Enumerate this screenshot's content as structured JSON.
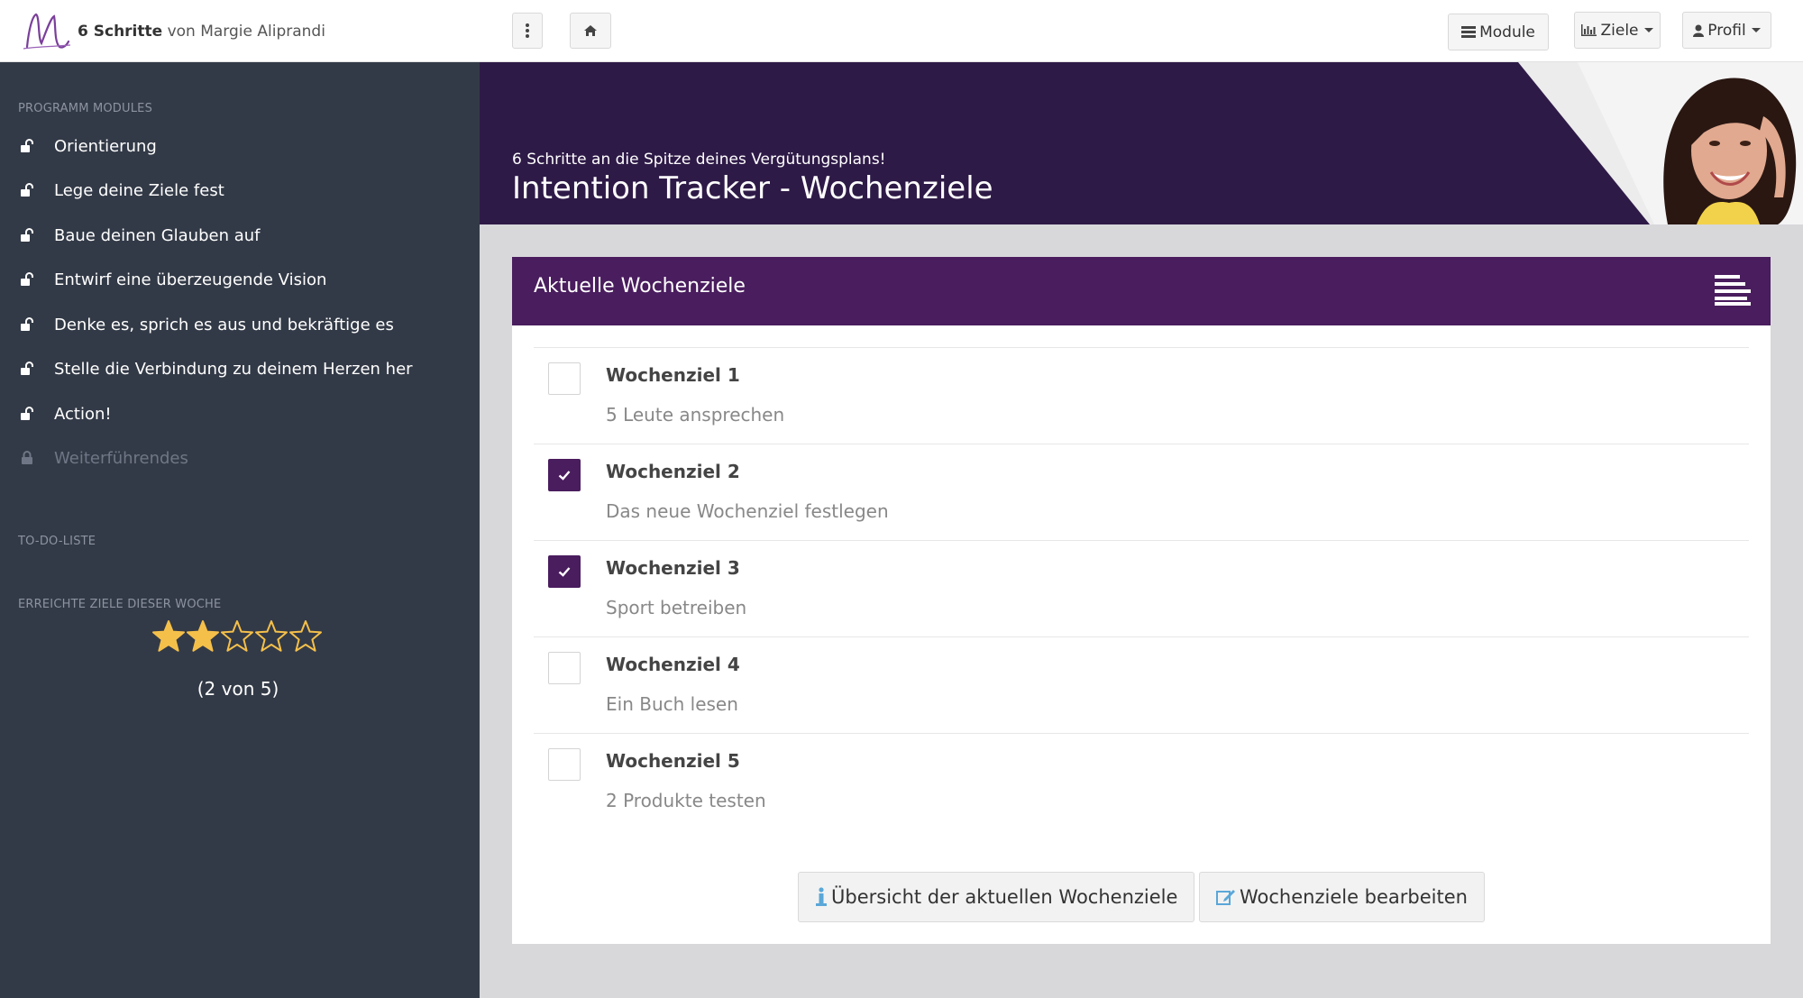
{
  "header": {
    "brand_bold": "6 Schritte",
    "brand_rest": " von Margie Aliprandi",
    "nav": {
      "modules_label": "Module",
      "goals_label": "Ziele",
      "profile_label": "Profil"
    }
  },
  "sidebar": {
    "modules_heading": "PROGRAMM MODULES",
    "items": [
      {
        "label": "Orientierung",
        "locked": false
      },
      {
        "label": "Lege deine Ziele fest",
        "locked": false
      },
      {
        "label": "Baue deinen Glauben auf",
        "locked": false
      },
      {
        "label": "Entwirf eine überzeugende Vision",
        "locked": false
      },
      {
        "label": "Denke es, sprich es aus und bekräftige es",
        "locked": false
      },
      {
        "label": "Stelle die Verbindung zu deinem Herzen her",
        "locked": false
      },
      {
        "label": "Action!",
        "locked": false
      },
      {
        "label": "Weiterführendes",
        "locked": true
      }
    ],
    "todo_heading": "TO-DO-LISTE",
    "goals_heading": "ERREICHTE ZIELE DIESER WOCHE",
    "rating": {
      "achieved": 2,
      "total": 5
    },
    "rating_text": "(2 von 5)"
  },
  "banner": {
    "subtitle": "6 Schritte an die Spitze deines Vergütungsplans!",
    "title": "Intention Tracker - Wochenziele"
  },
  "card": {
    "title": "Aktuelle Wochenziele",
    "goals": [
      {
        "title": "Wochenziel 1",
        "description": "5 Leute ansprechen",
        "checked": false
      },
      {
        "title": "Wochenziel 2",
        "description": "Das neue Wochenziel festlegen",
        "checked": true
      },
      {
        "title": "Wochenziel 3",
        "description": "Sport betreiben",
        "checked": true
      },
      {
        "title": "Wochenziel 4",
        "description": "Ein Buch lesen",
        "checked": false
      },
      {
        "title": "Wochenziel 5",
        "description": "2 Produkte testen",
        "checked": false
      }
    ],
    "overview_button": "Übersicht der aktuellen Wochenziele",
    "edit_button": "Wochenziele bearbeiten"
  },
  "colors": {
    "sidebar_bg": "#333a47",
    "banner_bg": "#2e1a47",
    "accent_purple": "#4a1d5e",
    "star_gold": "#f5c04a"
  },
  "icons": [
    "logo-m",
    "vertical-dots-icon",
    "home-icon",
    "list-icon",
    "bar-chart-icon",
    "user-icon",
    "unlock-icon",
    "lock-icon",
    "star-icon",
    "menu-lines-icon",
    "check-icon",
    "info-person-icon",
    "edit-icon"
  ]
}
